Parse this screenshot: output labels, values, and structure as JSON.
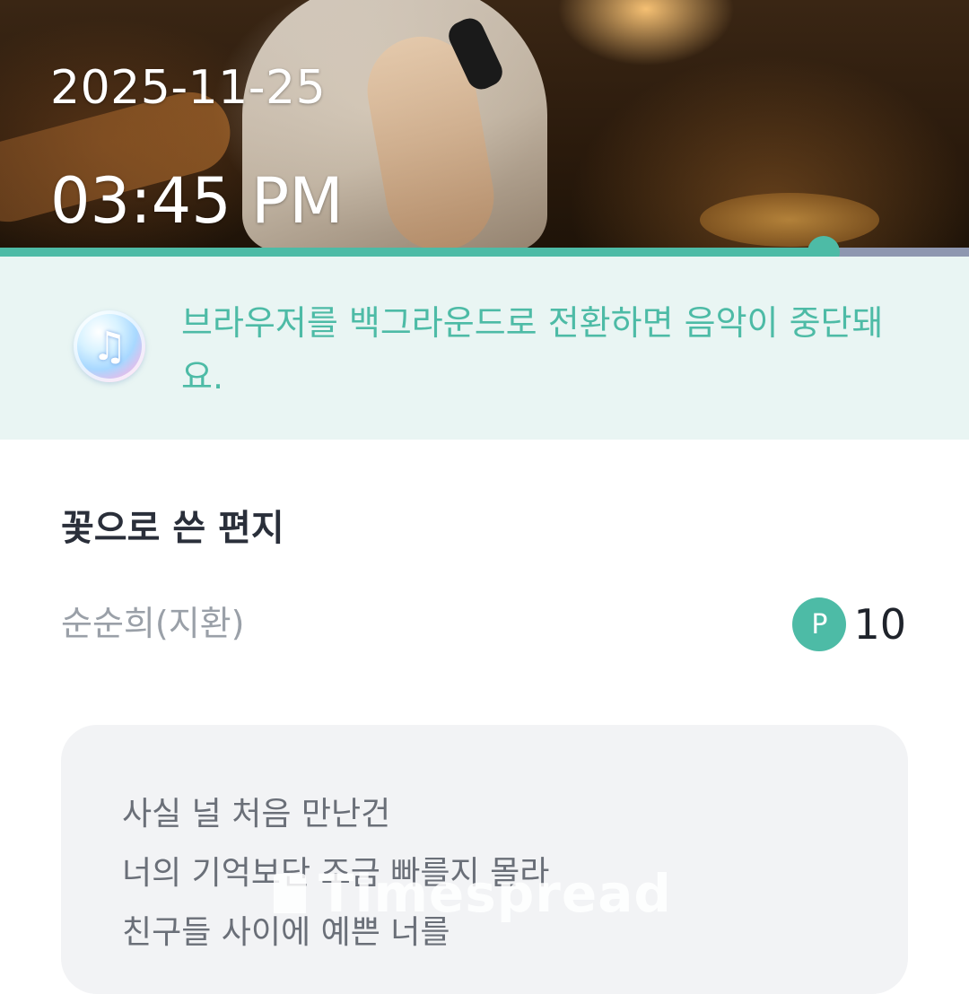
{
  "player": {
    "date": "2025-11-25",
    "time": "03:45 PM",
    "progress_percent": 85
  },
  "notice": {
    "icon": "music-note-icon",
    "text": "브라우저를 백그라운드로 전환하면 음악이 중단돼요."
  },
  "song": {
    "title": "꽃으로 쓴 편지",
    "artist": "순순희(지환)"
  },
  "points": {
    "badge": "P",
    "value": "10"
  },
  "lyrics": [
    "사실 널 처음 만난건",
    "너의 기억보단 조금 빠를지 몰라",
    "친구들 사이에 예쁜 너를"
  ],
  "watermark": "Timespread",
  "colors": {
    "accent": "#4dbba6",
    "notice_bg": "#e9f5f3",
    "lyrics_bg": "#f2f3f5"
  }
}
